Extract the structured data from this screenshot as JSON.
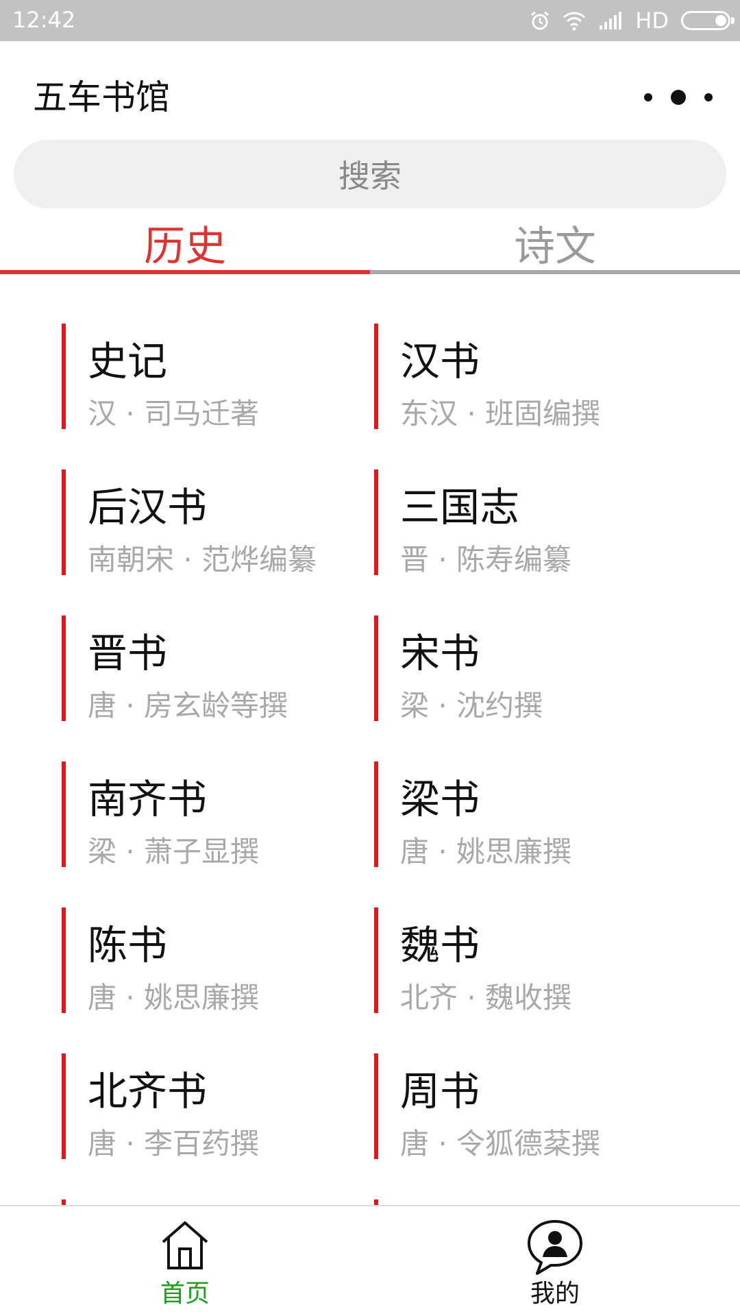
{
  "status_bar": {
    "time": "12:42",
    "network": "HD",
    "icons": [
      "alarm-icon",
      "wifi-icon",
      "signal-icon",
      "battery-icon"
    ]
  },
  "header": {
    "title": "五车书馆",
    "more_icon": "more-dots-icon"
  },
  "search": {
    "placeholder": "搜索"
  },
  "tabs": [
    {
      "label": "历史",
      "active": true
    },
    {
      "label": "诗文",
      "active": false
    }
  ],
  "books": [
    {
      "title": "史记",
      "author": "汉 · 司马迁著"
    },
    {
      "title": "汉书",
      "author": "东汉 · 班固编撰"
    },
    {
      "title": "后汉书",
      "author": "南朝宋 · 范烨编纂"
    },
    {
      "title": "三国志",
      "author": "晋 · 陈寿编纂"
    },
    {
      "title": "晋书",
      "author": "唐 · 房玄龄等撰"
    },
    {
      "title": "宋书",
      "author": "梁 · 沈约撰"
    },
    {
      "title": "南齐书",
      "author": "梁 · 萧子显撰"
    },
    {
      "title": "梁书",
      "author": "唐 · 姚思廉撰"
    },
    {
      "title": "陈书",
      "author": "唐 · 姚思廉撰"
    },
    {
      "title": "魏书",
      "author": "北齐 · 魏收撰"
    },
    {
      "title": "北齐书",
      "author": "唐 · 李百药撰"
    },
    {
      "title": "周书",
      "author": "唐 · 令狐德棻撰"
    }
  ],
  "bottom_nav": [
    {
      "label": "首页",
      "icon": "home-icon",
      "active": true
    },
    {
      "label": "我的",
      "icon": "profile-chat-icon",
      "active": false
    }
  ],
  "colors": {
    "accent": "#e0332f",
    "card_bar": "#e6141b",
    "nav_active": "#19a11c",
    "status_bar": "#c2c2c2"
  }
}
